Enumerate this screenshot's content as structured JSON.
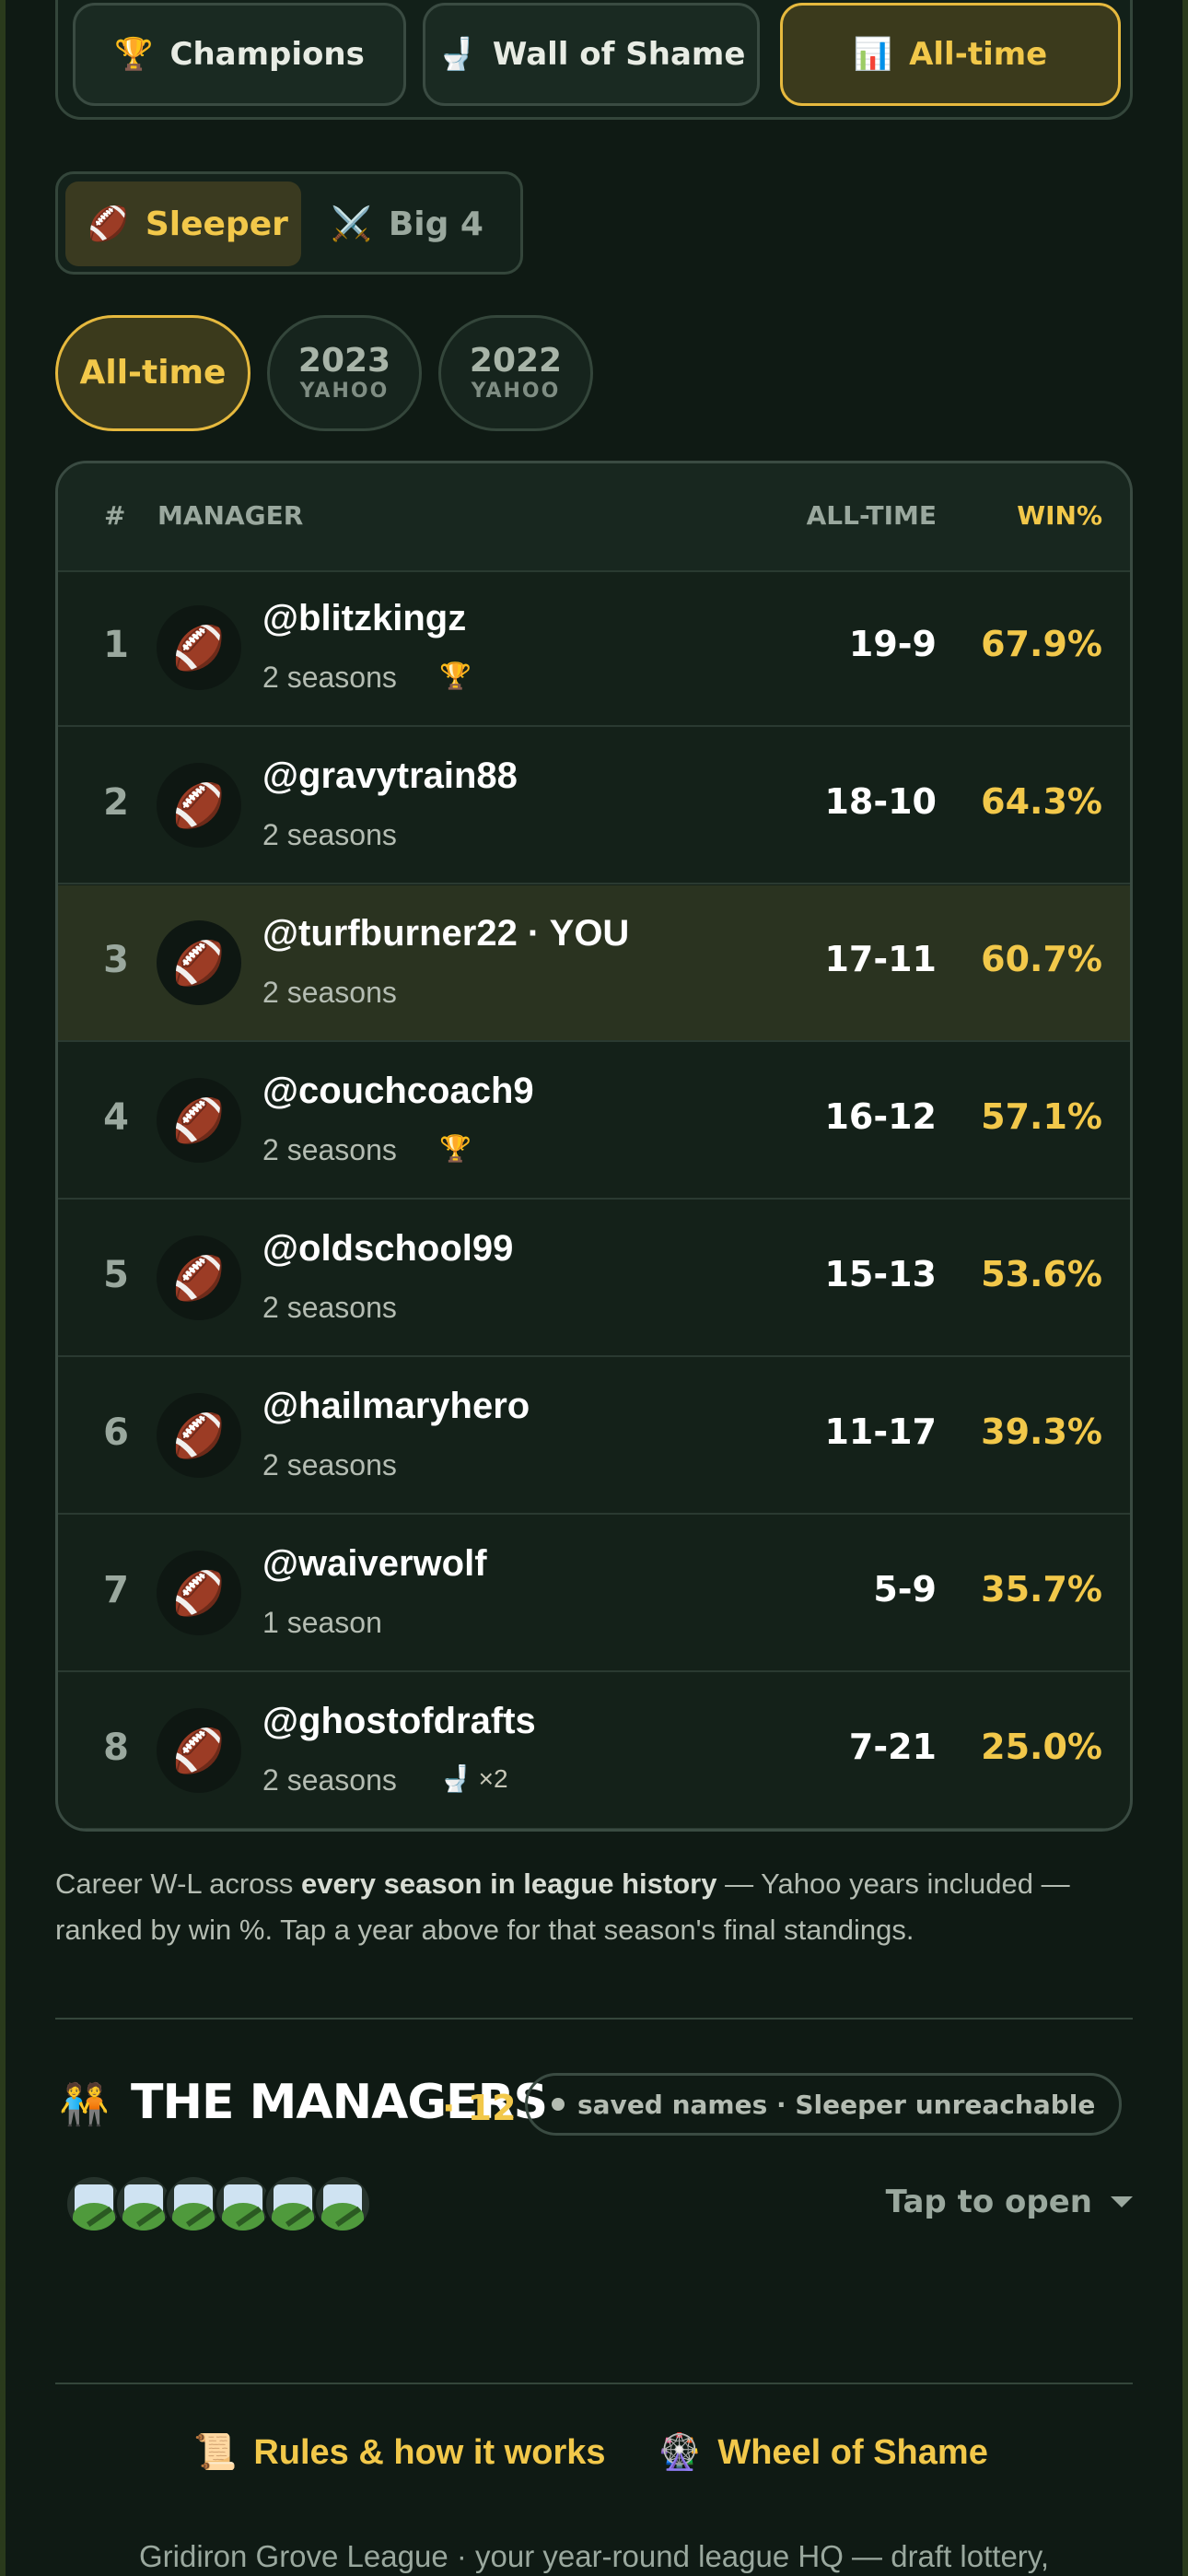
{
  "top_tabs": [
    {
      "icon": "🏆",
      "icon_name": "trophy-icon",
      "label": "Champions"
    },
    {
      "icon": "🚽",
      "icon_name": "toilet-icon",
      "label": "Wall of Shame"
    },
    {
      "icon": "📊",
      "icon_name": "bar-chart-icon",
      "label": "All-time"
    }
  ],
  "source_toggle": [
    {
      "icon": "🏈",
      "icon_name": "football-icon",
      "label": "Sleeper"
    },
    {
      "icon": "⚔️",
      "icon_name": "crossed-swords-icon",
      "label": "Big 4"
    }
  ],
  "year_pills": [
    {
      "label": "All-time",
      "sub": ""
    },
    {
      "label": "2023",
      "sub": "YAHOO"
    },
    {
      "label": "2022",
      "sub": "YAHOO"
    }
  ],
  "table": {
    "headers": {
      "rank": "#",
      "manager": "MANAGER",
      "record": "ALL-TIME",
      "win_pct": "WIN%"
    },
    "avatar_icon": "🏈",
    "rows": [
      {
        "rank": "1",
        "name": "@blitzkingz",
        "seasons": "2 seasons",
        "badge": "🏆",
        "record": "19-9",
        "win_pct": "67.9%"
      },
      {
        "rank": "2",
        "name": "@gravytrain88",
        "seasons": "2 seasons",
        "badge": "",
        "record": "18-10",
        "win_pct": "64.3%"
      },
      {
        "rank": "3",
        "name": "@turfburner22 · YOU",
        "seasons": "2 seasons",
        "badge": "",
        "record": "17-11",
        "win_pct": "60.7%"
      },
      {
        "rank": "4",
        "name": "@couchcoach9",
        "seasons": "2 seasons",
        "badge": "🏆",
        "record": "16-12",
        "win_pct": "57.1%"
      },
      {
        "rank": "5",
        "name": "@oldschool99",
        "seasons": "2 seasons",
        "badge": "",
        "record": "15-13",
        "win_pct": "53.6%"
      },
      {
        "rank": "6",
        "name": "@hailmaryhero",
        "seasons": "2 seasons",
        "badge": "",
        "record": "11-17",
        "win_pct": "39.3%"
      },
      {
        "rank": "7",
        "name": "@waiverwolf",
        "seasons": "1 season",
        "badge": "",
        "record": "5-9",
        "win_pct": "35.7%"
      },
      {
        "rank": "8",
        "name": "@ghostofdrafts",
        "seasons": "2 seasons",
        "badge": "🚽 ×2",
        "record": "7-21",
        "win_pct": "25.0%"
      }
    ]
  },
  "note": {
    "part1": "Career W-L across ",
    "bold": "every season in league history",
    "part2": " — Yahoo years included — ranked by win %. Tap a year above for that season's final standings."
  },
  "managers": {
    "icon": "🧑‍🤝‍🧑",
    "title": "THE MANAGERS",
    "count": "· 12",
    "status": "saved names · Sleeper unreachable",
    "tap_label": "Tap to open"
  },
  "links": [
    {
      "icon": "📜",
      "icon_name": "scroll-icon",
      "label": "Rules & how it works"
    },
    {
      "icon": "🎡",
      "icon_name": "ferris-wheel-icon",
      "label": "Wheel of Shame"
    }
  ],
  "footer": "Gridiron Grove League · your year-round league HQ — draft lottery,"
}
